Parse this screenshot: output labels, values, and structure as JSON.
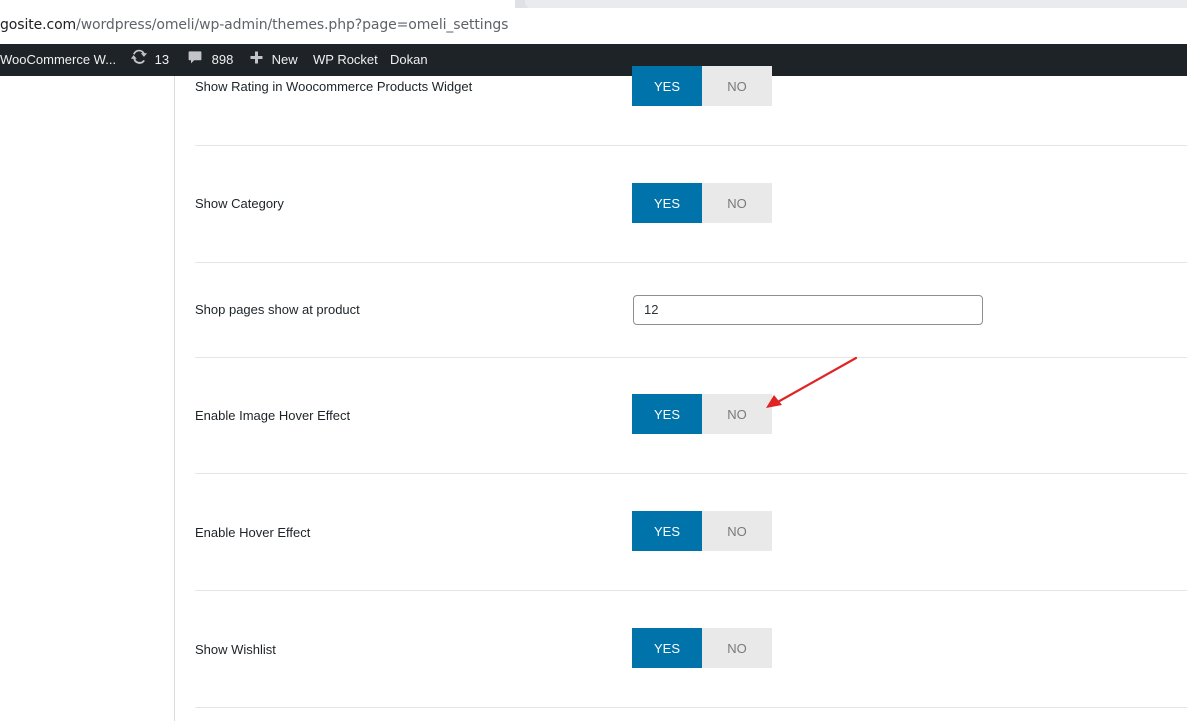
{
  "browser": {
    "url_host": "gosite.com",
    "url_path": "/wordpress/omeli/wp-admin/themes.php?page=omeli_settings"
  },
  "adminbar": {
    "site_name": "WooCommerce W...",
    "updates_count": "13",
    "comments_count": "898",
    "new_label": "New",
    "wp_rocket_label": "WP Rocket",
    "dokan_label": "Dokan"
  },
  "settings": {
    "rows": [
      {
        "label": "Show Rating in Woocommerce Products Widget",
        "yes": "YES",
        "no": "NO",
        "selected": "YES"
      },
      {
        "label": "Show Category",
        "yes": "YES",
        "no": "NO",
        "selected": "YES"
      },
      {
        "label": "Shop pages show at product",
        "value": "12"
      },
      {
        "label": "Enable Image Hover Effect",
        "yes": "YES",
        "no": "NO",
        "selected": "YES"
      },
      {
        "label": "Enable Hover Effect",
        "yes": "YES",
        "no": "NO",
        "selected": "YES"
      },
      {
        "label": "Show Wishlist",
        "yes": "YES",
        "no": "NO",
        "selected": "YES"
      }
    ]
  },
  "colors": {
    "accent": "#0073aa",
    "adminbar_bg": "#1d2327",
    "annotation_arrow": "#e02424"
  }
}
